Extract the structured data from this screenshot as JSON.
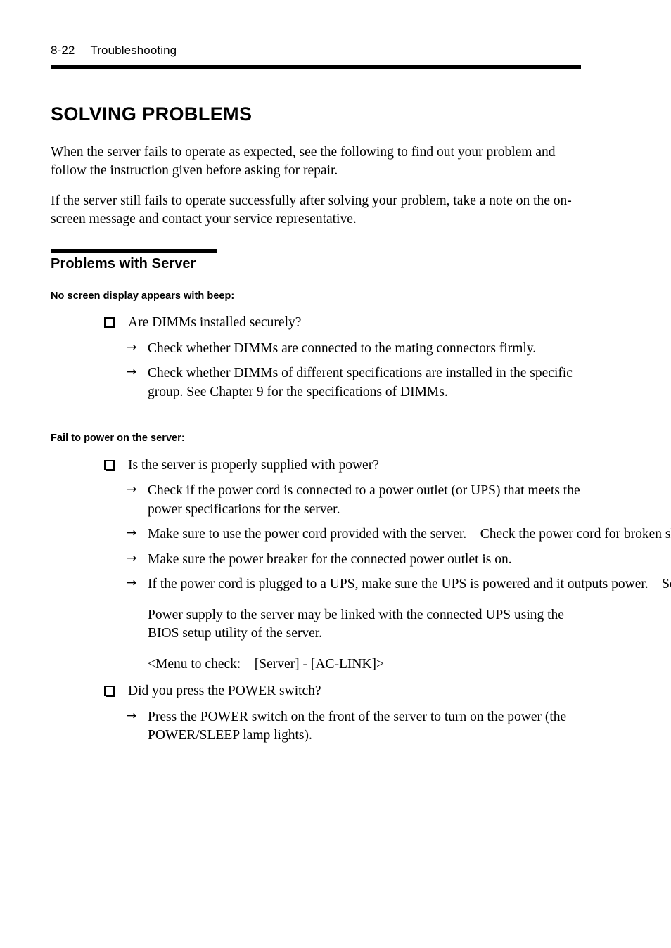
{
  "header": {
    "folio": "8-22",
    "chapter_name": "Troubleshooting"
  },
  "title": "SOLVING PROBLEMS",
  "intro": {
    "para1": "When the server fails to operate as expected, see the following to find out your problem and follow the instruction given before asking for repair.",
    "para2": "If the server still fails to operate successfully after solving your problem, take a note on the on-screen message and contact your service representative."
  },
  "section": {
    "title": "Problems with Server"
  },
  "subsections": [
    {
      "heading": "No screen display appears with beep:",
      "questions": [
        {
          "text": "Are DIMMs installed securely?",
          "answers": [
            "Check whether DIMMs are connected to the mating connectors firmly.",
            "Check whether DIMMs of different specifications are installed in the specific group. See Chapter 9 for the specifications of DIMMs."
          ]
        }
      ]
    },
    {
      "heading": "Fail to power on the server:",
      "questions": [
        {
          "text": "Is the server is properly supplied with power?",
          "answers": [
            "Check if the power cord is connected to a power outlet (or UPS) that meets the power specifications for the server.",
            "Make sure to use the power cord provided with the server.    Check the power cord for broken shield or bent plugs.",
            "Make sure the power breaker for the connected power outlet is on.",
            "If the power cord is plugged to a UPS, make sure the UPS is powered and it outputs power.    See the manual that comes with the UPS for details."
          ],
          "notes": [
            "Power supply to the server may be linked with the connected UPS using the BIOS setup utility of the server.",
            "<Menu to check:    [Server] - [AC-LINK]>"
          ]
        },
        {
          "text": "Did you press the POWER switch?",
          "answers": [
            "Press the POWER switch on the front of the server to turn on the power (the POWER/SLEEP lamp lights)."
          ]
        }
      ]
    }
  ],
  "icons": {
    "bullet": "checkbox-square",
    "arrow": "→"
  }
}
